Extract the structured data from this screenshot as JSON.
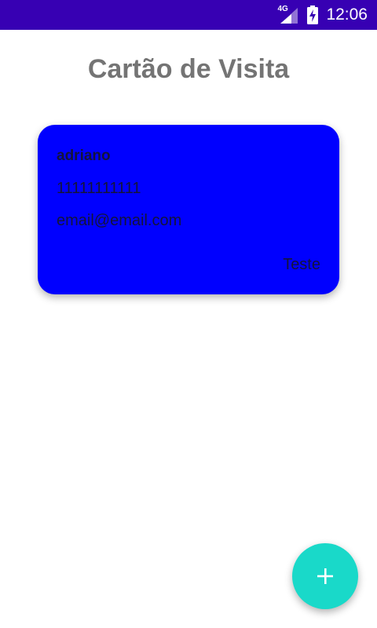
{
  "status_bar": {
    "network_type": "4G",
    "time": "12:06",
    "signal_icon": "cell-signal-icon",
    "battery_icon": "battery-charging-icon",
    "background_color": "#3700b3"
  },
  "header": {
    "title": "Cartão de Visita"
  },
  "cards": [
    {
      "name": "adriano",
      "phone": "11111111111",
      "email": "email@email.com",
      "company": "Teste",
      "background_color": "#0000ff"
    }
  ],
  "fab": {
    "icon": "plus-icon",
    "color": "#19d9c9"
  }
}
